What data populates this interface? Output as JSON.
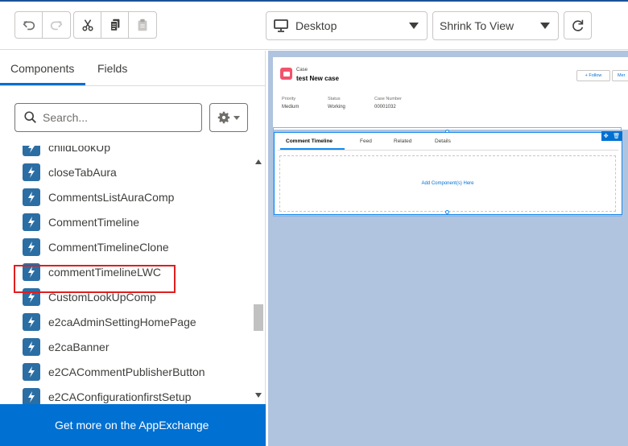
{
  "toolbar": {
    "undo_icon": "undo-icon",
    "redo_icon": "redo-icon",
    "cut_icon": "cut-icon",
    "copy_icon": "copy-icon",
    "paste_icon": "paste-icon",
    "device_select": {
      "icon": "desktop-icon",
      "value": "Desktop"
    },
    "zoom_select": {
      "value": "Shrink To View"
    },
    "refresh_icon": "refresh-icon"
  },
  "left_panel": {
    "tabs": [
      {
        "label": "Components",
        "active": true
      },
      {
        "label": "Fields",
        "active": false
      }
    ],
    "search": {
      "placeholder": "Search..."
    },
    "components": [
      "childLookUp",
      "closeTabAura",
      "CommentsListAuraComp",
      "CommentTimeline",
      "CommentTimelineClone",
      "commentTimelineLWC",
      "CustomLookUpComp",
      "e2caAdminSettingHomePage",
      "e2caBanner",
      "e2CACommentPublisherButton",
      "e2CAConfigurationfirstSetup"
    ],
    "highlighted_component": "commentTimelineLWC",
    "appexchange_label": "Get more on the AppExchange"
  },
  "canvas": {
    "record": {
      "object_label": "Case",
      "title": "test New case",
      "follow_label": "+ Follow",
      "more_label": "Mer",
      "fields": [
        {
          "label": "Priority",
          "value": "Medium"
        },
        {
          "label": "Status",
          "value": "Working"
        },
        {
          "label": "Case Number",
          "value": "00001032"
        }
      ]
    },
    "tabs": [
      "Comment Timeline",
      "Feed",
      "Related",
      "Details"
    ],
    "drop_zone_label": "Add Component(s) Here"
  },
  "colors": {
    "brand_blue": "#0070d2",
    "canvas_bg": "#b0c4df",
    "highlight_red": "#e01e1e",
    "component_icon": "#2b6ea4",
    "case_icon": "#f2536d"
  }
}
